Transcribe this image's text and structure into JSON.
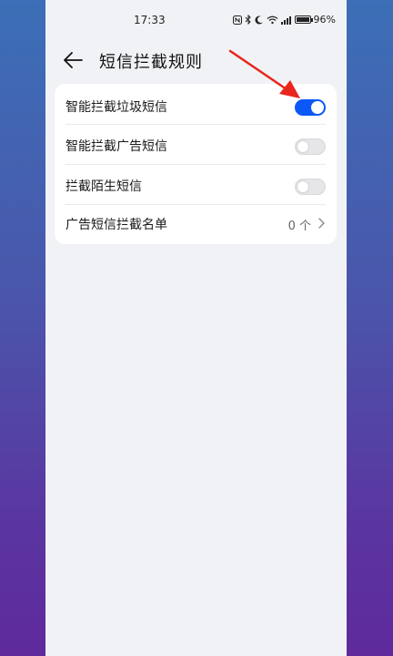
{
  "status_bar": {
    "time": "17:33",
    "battery_percent": "96%",
    "icons": [
      "nfc-icon",
      "bluetooth-icon",
      "moon-icon",
      "wifi-icon",
      "signal-icon",
      "battery-icon"
    ]
  },
  "header": {
    "title": "短信拦截规则",
    "back_icon": "back-arrow-icon"
  },
  "settings": {
    "rows": [
      {
        "label": "智能拦截垃圾短信",
        "type": "toggle",
        "enabled": true
      },
      {
        "label": "智能拦截广告短信",
        "type": "toggle",
        "enabled": false
      },
      {
        "label": "拦截陌生短信",
        "type": "toggle",
        "enabled": false
      },
      {
        "label": "广告短信拦截名单",
        "type": "link",
        "value": "0 个"
      }
    ]
  },
  "colors": {
    "accent": "#0a59f7",
    "annotation": "#e8261c",
    "page_bg": "#f1f2f6",
    "card_bg": "#ffffff"
  }
}
